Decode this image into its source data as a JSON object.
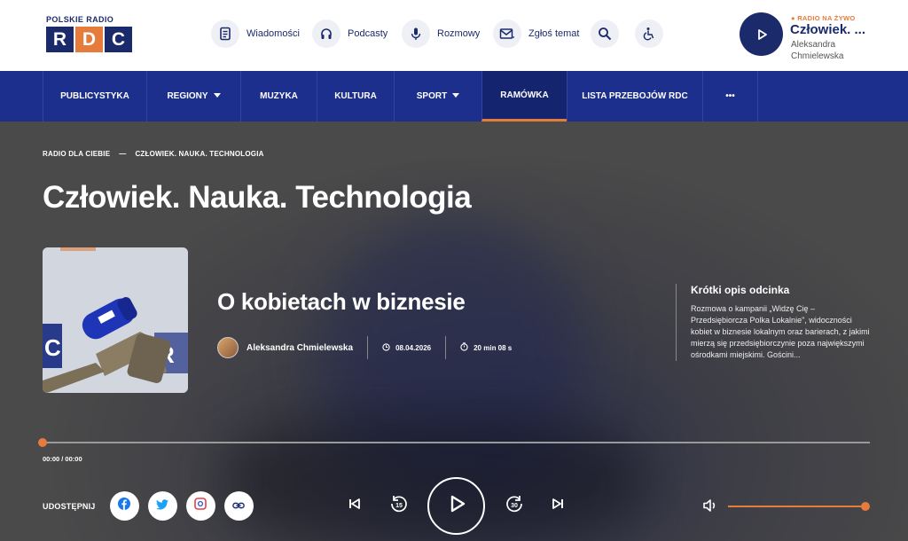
{
  "header": {
    "logo": {
      "top": "POLSKIE RADIO",
      "letters": [
        "R",
        "D",
        "C"
      ],
      "colors": [
        "#1b2a6b",
        "#e57c3b",
        "#1b2a6b"
      ]
    },
    "nav": [
      {
        "label": "Wiadomości",
        "icon": "document-icon"
      },
      {
        "label": "Podcasty",
        "icon": "headphones-icon"
      },
      {
        "label": "Rozmowy",
        "icon": "microphone-icon"
      },
      {
        "label": "Zgłoś temat",
        "icon": "mail-icon"
      }
    ],
    "search_icon": "search-icon",
    "accessibility_icon": "accessibility-icon",
    "live": {
      "badge": "RADIO NA ŻYWO",
      "title": "Człowiek. ...",
      "person": "Aleksandra Chmielewska"
    }
  },
  "mainnav": [
    {
      "label": "PUBLICYSTYKA"
    },
    {
      "label": "REGIONY",
      "dropdown": true
    },
    {
      "label": "MUZYKA"
    },
    {
      "label": "KULTURA"
    },
    {
      "label": "SPORT",
      "dropdown": true
    },
    {
      "label": "RAMÓWKA",
      "active": true
    },
    {
      "label": "LISTA PRZEBOJÓW RDC"
    },
    {
      "label": "•••"
    }
  ],
  "breadcrumb": {
    "home": "RADIO DLA CIEBIE",
    "separator": "—",
    "current": "CZŁOWIEK. NAUKA. TECHNOLOGIA"
  },
  "page_title": "Człowiek. Nauka. Technologia",
  "episode": {
    "title": "O kobietach w biznesie",
    "author": "Aleksandra Chmielewska",
    "date": "08.04.2026",
    "duration": "20 min 08 s",
    "desc_title": "Krótki opis odcinka",
    "desc_text": "Rozmowa o kampanii „Widzę Cię – Przedsiębiorcza Polka Lokalnie\", widoczności kobiet w biznesie lokalnym oraz barierach, z jakimi mierzą się przedsiębiorczynie poza największymi ośrodkami miejskimi. Gościni..."
  },
  "player": {
    "time": "00:00 / 00:00",
    "progress": 0,
    "volume": 1,
    "share_label": "UDOSTĘPNIJ",
    "share_buttons": [
      "facebook-icon",
      "twitter-icon",
      "image-share-icon",
      "link-icon"
    ],
    "skip_back_seconds": "15",
    "skip_forward_seconds": "30"
  },
  "colors": {
    "accent": "#e57c3b",
    "navy": "#1b2a6b",
    "nav_bg": "#1d2f8c"
  }
}
